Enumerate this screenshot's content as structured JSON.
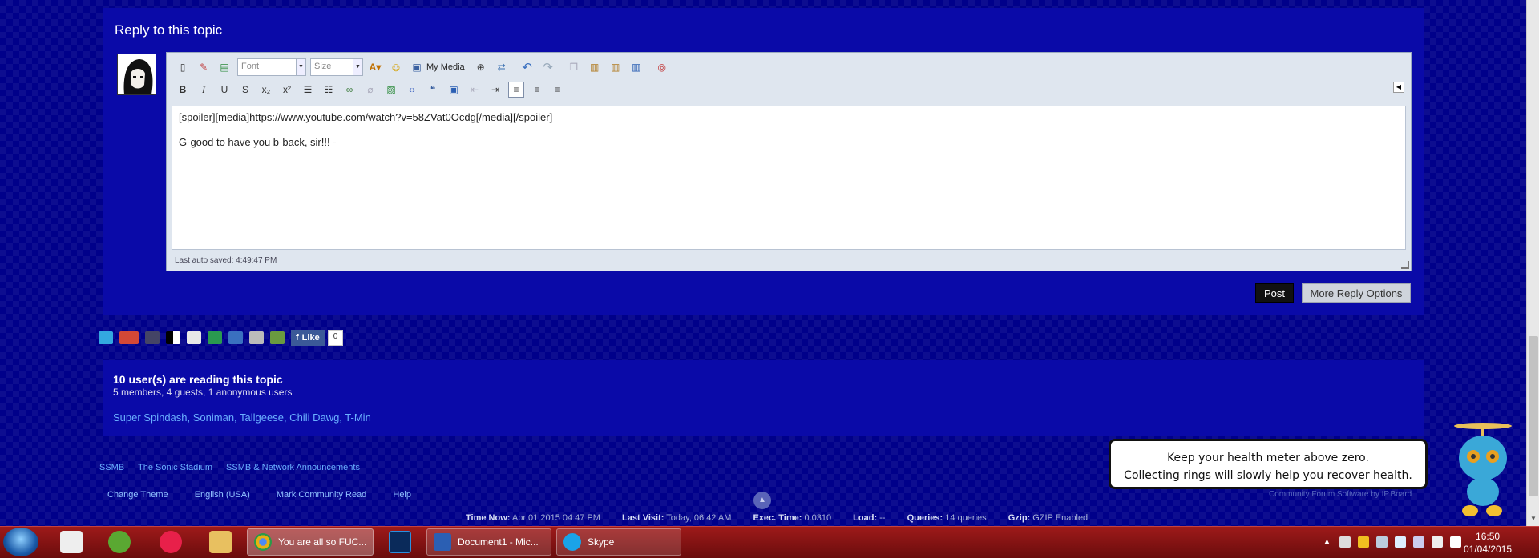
{
  "reply": {
    "title": "Reply to this topic",
    "font_label": "Font",
    "size_label": "Size",
    "my_media_label": "My Media",
    "line1": "[spoiler][media]https://www.youtube.com/watch?v=58ZVat0Ocdg[/media][/spoiler]",
    "line2": "G-good to have you b-back, sir!!! -",
    "autosave": "Last auto saved: 4:49:47 PM",
    "post_label": "Post",
    "more_label": "More Reply Options"
  },
  "social": {
    "like_label": "Like",
    "like_count": "0"
  },
  "users": {
    "title": "10 user(s) are reading this topic",
    "subtitle": "5 members, 4 guests, 1 anonymous users",
    "names": "Super Spindash, Soniman, Tallgeese, Chili Dawg, T-Min"
  },
  "footer": {
    "links": [
      "SSMB",
      "The Sonic Stadium",
      "SSMB & Network Announcements"
    ],
    "nav": [
      "Change Theme",
      "English (USA)",
      "Mark Community Read",
      "Help"
    ],
    "credit": "Community Forum Software by IP.Board",
    "stats": {
      "time_now_label": "Time Now:",
      "time_now": "Apr 01 2015 04:47 PM",
      "last_visit_label": "Last Visit:",
      "last_visit": "Today, 06:42 AM",
      "exec_label": "Exec. Time:",
      "exec": "0.0310",
      "load_label": "Load:",
      "load": "--",
      "queries_label": "Queries:",
      "queries": "14 queries",
      "gzip_label": "Gzip:",
      "gzip": "GZIP Enabled"
    }
  },
  "tooltip": {
    "line1": "Keep your health meter above zero.",
    "line2": "Collecting rings will slowly help you recover health."
  },
  "taskbar": {
    "windows": [
      {
        "label": "You are all so FUC...",
        "color": "#d9a300"
      },
      {
        "label": "Document1 - Mic...",
        "color": "#2b5fb3"
      },
      {
        "label": "Skype",
        "color": "#1aa3e8"
      }
    ],
    "clock_time": "16:50",
    "clock_date": "01/04/2015"
  },
  "colors": {
    "panel": "#0a0aa8",
    "background": "#00008a",
    "link": "#6ab0ff",
    "taskbar": "#8a1414"
  }
}
